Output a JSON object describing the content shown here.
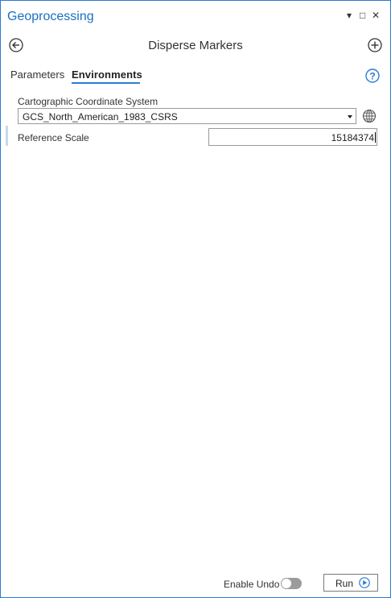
{
  "pane": {
    "title": "Geoprocessing",
    "controls": {
      "menu": "▾",
      "maximize": "□",
      "close": "✕"
    }
  },
  "tool": {
    "title": "Disperse Markers",
    "back_icon": "back-arrow-icon",
    "add_icon": "plus-circle-icon"
  },
  "tabs": [
    {
      "label": "Parameters",
      "active": false
    },
    {
      "label": "Environments",
      "active": true
    }
  ],
  "help_icon": "help-icon",
  "environments": {
    "coordinate_system": {
      "label": "Cartographic Coordinate System",
      "value": "GCS_North_American_1983_CSRS",
      "icon": "globe-icon"
    },
    "reference_scale": {
      "label": "Reference Scale",
      "value": "15184374"
    }
  },
  "footer": {
    "enable_undo_label": "Enable Undo",
    "enable_undo_on": false,
    "run_label": "Run",
    "run_icon": "play-icon"
  },
  "colors": {
    "accent": "#2a7bd3",
    "title": "#1a6fc2",
    "toggle_off": "#9b9b9b"
  }
}
